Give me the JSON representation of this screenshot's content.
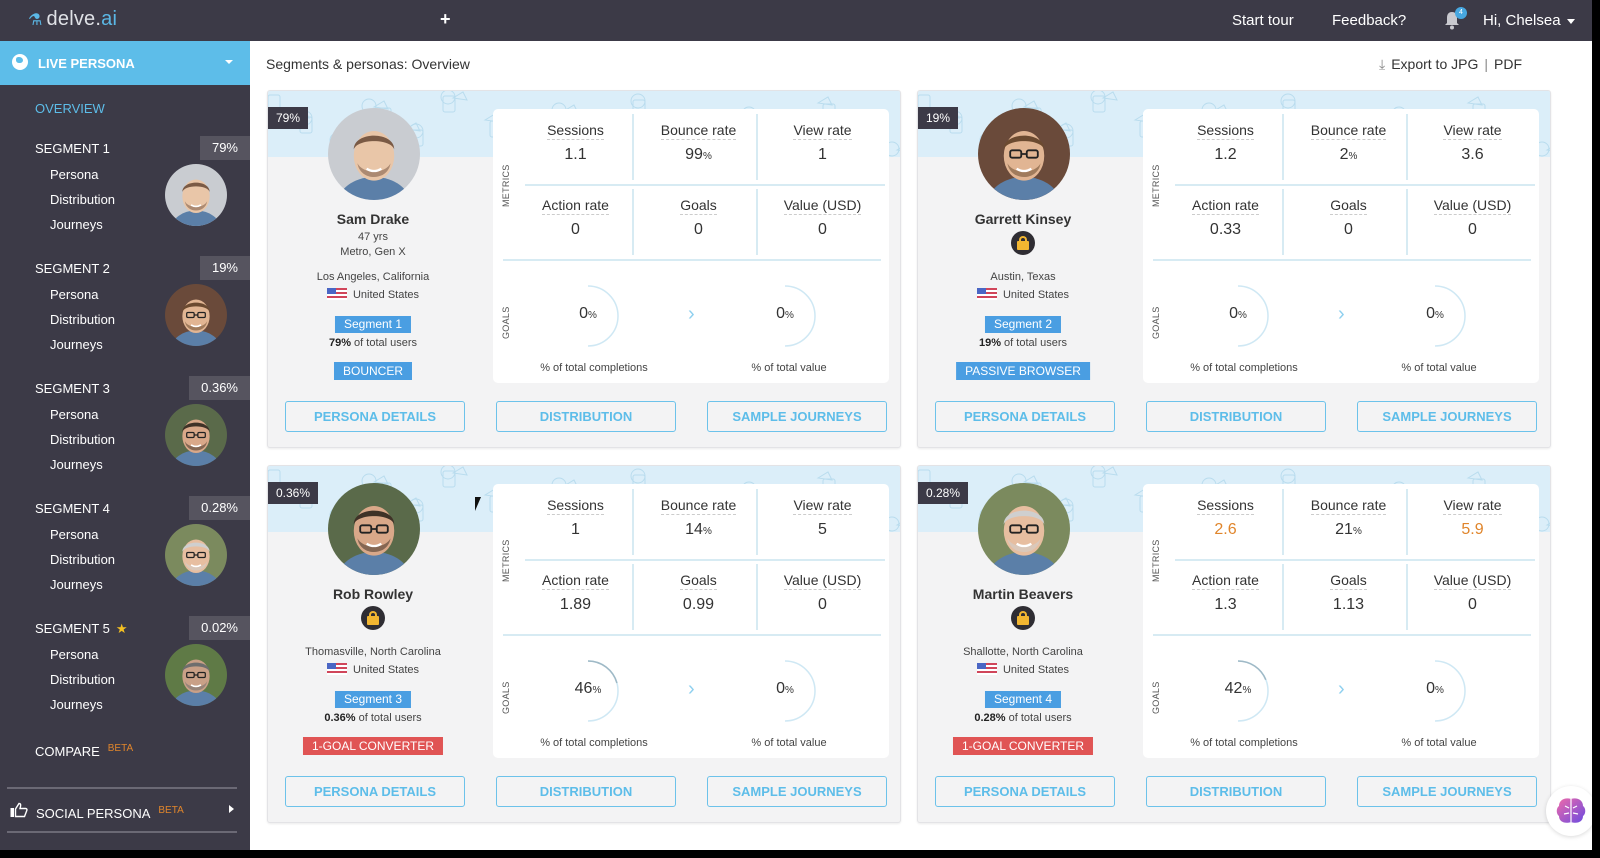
{
  "topbar": {
    "logo_main": "delve.",
    "logo_accent": "ai",
    "add_icon": "+",
    "start_tour": "Start tour",
    "feedback": "Feedback?",
    "notification_count": "4",
    "user_greeting": "Hi, Chelsea"
  },
  "sidebar": {
    "live_persona": "LIVE PERSONA",
    "overview": "OVERVIEW",
    "segments": [
      {
        "title": "SEGMENT 1",
        "pct": "79%",
        "starred": false,
        "links": [
          "Persona",
          "Distribution",
          "Journeys"
        ]
      },
      {
        "title": "SEGMENT 2",
        "pct": "19%",
        "starred": false,
        "links": [
          "Persona",
          "Distribution",
          "Journeys"
        ]
      },
      {
        "title": "SEGMENT 3",
        "pct": "0.36%",
        "starred": false,
        "links": [
          "Persona",
          "Distribution",
          "Journeys"
        ]
      },
      {
        "title": "SEGMENT 4",
        "pct": "0.28%",
        "starred": false,
        "links": [
          "Persona",
          "Distribution",
          "Journeys"
        ]
      },
      {
        "title": "SEGMENT 5",
        "pct": "0.02%",
        "starred": true,
        "star": "★",
        "links": [
          "Persona",
          "Distribution",
          "Journeys"
        ]
      }
    ],
    "compare": "COMPARE",
    "compare_badge": "BETA",
    "social_persona": "SOCIAL PERSONA",
    "social_badge": "BETA"
  },
  "main": {
    "breadcrumb": "Segments & personas: Overview",
    "export_label": "Export to JPG",
    "export_sep": "|",
    "export_pdf": "PDF"
  },
  "labels": {
    "metrics": "METRICS",
    "goals": "GOALS",
    "sessions": "Sessions",
    "bounce_rate": "Bounce rate",
    "view_rate": "View rate",
    "action_rate": "Action rate",
    "goals_metric": "Goals",
    "value_usd": "Value (USD)",
    "pct_completions": "% of total completions",
    "pct_value": "% of total value",
    "percent_sign": "%",
    "of_total_users": " of total users",
    "persona_details": "PERSONA DETAILS",
    "distribution": "DISTRIBUTION",
    "sample_journeys": "SAMPLE JOURNEYS"
  },
  "colors": {
    "accent": "#5dbde9",
    "dark": "#3c3a47",
    "badge_blue": "#4a9ee2",
    "badge_red": "#e05454",
    "highlight_orange": "#e0852b"
  },
  "personas": [
    {
      "pct": "79%",
      "name": "Sam Drake",
      "age": "47 yrs",
      "demo": "Metro, Gen X",
      "locked": false,
      "city": "Los Angeles, California",
      "country": "United States",
      "segment": "Segment 1",
      "users_pct": "79%",
      "type": "BOUNCER",
      "type_color": "#4a9ee2",
      "sessions": "1.1",
      "bounce": "99",
      "view_rate": "1",
      "action_rate": "0",
      "goals": "0",
      "value": "0",
      "completions": "0",
      "total_value": "0",
      "completions_frac": 0,
      "value_frac": 0,
      "highlight_sessions": false,
      "highlight_view": false
    },
    {
      "pct": "19%",
      "name": "Garrett Kinsey",
      "locked": true,
      "city": "Austin, Texas",
      "country": "United States",
      "segment": "Segment 2",
      "users_pct": "19%",
      "type": "PASSIVE BROWSER",
      "type_color": "#4a9ee2",
      "sessions": "1.2",
      "bounce": "2",
      "view_rate": "3.6",
      "action_rate": "0.33",
      "goals": "0",
      "value": "0",
      "completions": "0",
      "total_value": "0",
      "completions_frac": 0,
      "value_frac": 0,
      "highlight_sessions": false,
      "highlight_view": false
    },
    {
      "pct": "0.36%",
      "name": "Rob Rowley",
      "locked": true,
      "city": "Thomasville, North Carolina",
      "country": "United States",
      "segment": "Segment 3",
      "users_pct": "0.36%",
      "type": "1-GOAL CONVERTER",
      "type_color": "#e05454",
      "sessions": "1",
      "bounce": "14",
      "view_rate": "5",
      "action_rate": "1.89",
      "goals": "0.99",
      "value": "0",
      "completions": "46",
      "total_value": "0",
      "completions_frac": 0.46,
      "value_frac": 0,
      "highlight_sessions": false,
      "highlight_view": false
    },
    {
      "pct": "0.28%",
      "name": "Martin Beavers",
      "locked": true,
      "city": "Shallotte, North Carolina",
      "country": "United States",
      "segment": "Segment 4",
      "users_pct": "0.28%",
      "type": "1-GOAL CONVERTER",
      "type_color": "#e05454",
      "sessions": "2.6",
      "bounce": "21",
      "view_rate": "5.9",
      "action_rate": "1.3",
      "goals": "1.13",
      "value": "0",
      "completions": "42",
      "total_value": "0",
      "completions_frac": 0.42,
      "value_frac": 0,
      "highlight_sessions": true,
      "highlight_view": true
    }
  ]
}
